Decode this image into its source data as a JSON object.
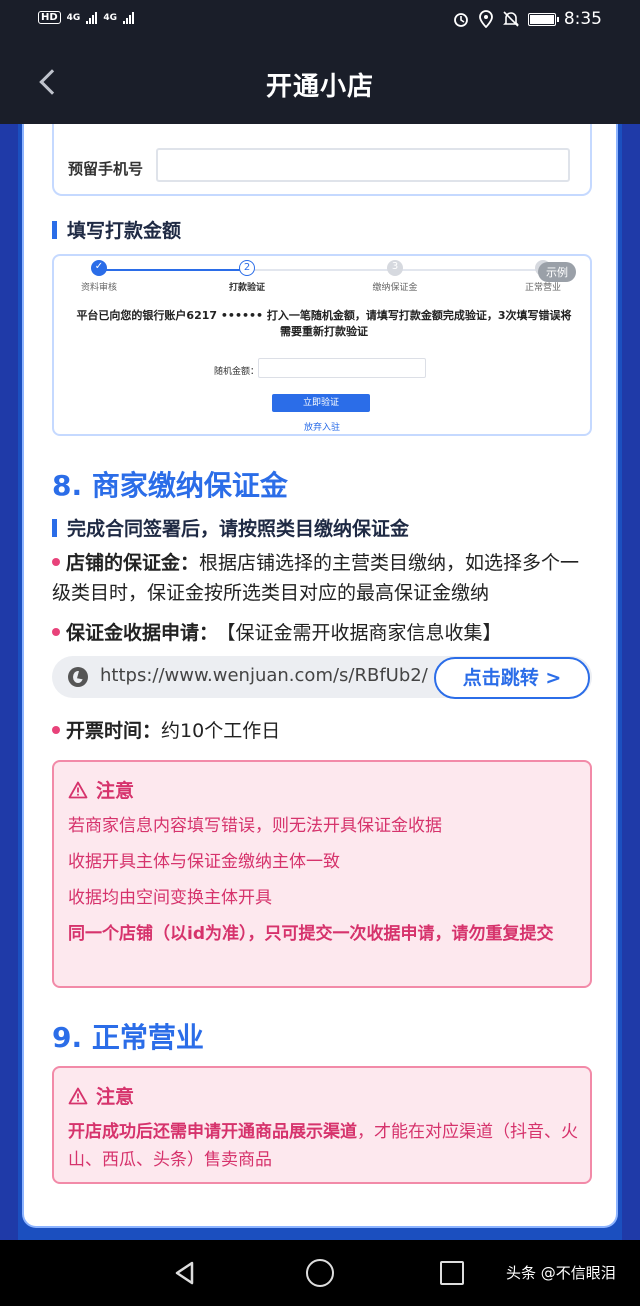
{
  "status_bar": {
    "hd": "HD",
    "net1": "4G",
    "net2": "4G",
    "time": "8:35",
    "icons": [
      "alarm-icon",
      "location-icon",
      "mute-icon",
      "battery-icon"
    ]
  },
  "header": {
    "title": "开通小店",
    "back_icon": "chevron-left-icon"
  },
  "phone_section": {
    "label": "预留手机号",
    "value": ""
  },
  "payment_section": {
    "heading": "填写打款金额",
    "steps": [
      {
        "label": "资料审核",
        "mark": "✓",
        "state": "done"
      },
      {
        "label": "打款验证",
        "mark": "2",
        "state": "current"
      },
      {
        "label": "缴纳保证金",
        "mark": "3",
        "state": "todo"
      },
      {
        "label": "正常营业",
        "mark": "",
        "state": "todo"
      }
    ],
    "sample_badge": "示例",
    "message": "平台已向您的银行账户6217 •••••• 打入一笔随机金额，请填写打款金额完成验证，3次填写错误将需要重新打款验证",
    "amount_label": "随机金额：",
    "verify_button": "立即验证",
    "abandon_link": "放弃入驻"
  },
  "deposit_section": {
    "heading": "8. 商家缴纳保证金",
    "subheading": "完成合同签署后，请按照类目缴纳保证金",
    "shop_deposit_label": "店铺的保证金：",
    "shop_deposit_text": "根据店铺选择的主营类目缴纳，如选择多个一级类目时，保证金按所选类目对应的最高保证金缴纳",
    "receipt_label": "保证金收据申请：",
    "receipt_text": "【保证金需开收据商家信息收集】",
    "url": "https://www.wenjuan.com/s/RBfUb2/",
    "jump_button": "点击跳转 >",
    "invoice_label": "开票时间：",
    "invoice_text": "约10个工作日"
  },
  "notice1": {
    "title": "注意",
    "items": [
      "若商家信息内容填写错误，则无法开具保证金收据",
      "收据开具主体与保证金缴纳主体一致",
      "收据均由空间变换主体开具"
    ],
    "strong": "同一个店铺（以id为准），只可提交一次收据申请，请勿重复提交"
  },
  "business_section": {
    "heading": "9. 正常营业"
  },
  "notice2": {
    "title": "注意",
    "strong": "开店成功后还需申请开通商品展示渠道",
    "text": "，才能在对应渠道（抖音、火山、西瓜、头条）售卖商品"
  },
  "watermark": "头条 @不信眼泪"
}
